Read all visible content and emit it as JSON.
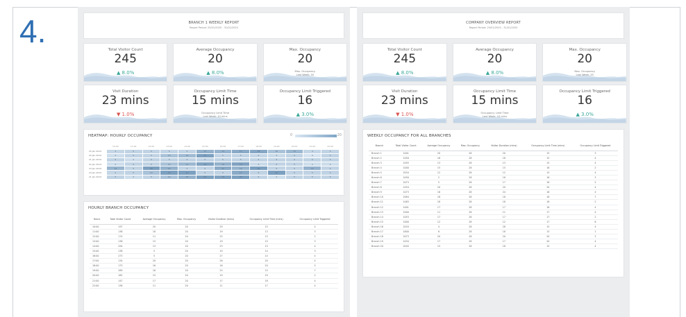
{
  "step_number": "4.",
  "branch_report": {
    "title": "BRANCH 1 WEEKLY REPORT",
    "period": "Report Period: 25/01/2020 - 31/01/2020",
    "kpis": [
      {
        "label": "Total Visitor Count",
        "value": "245",
        "change": "▲ 8.0%",
        "trend": "up"
      },
      {
        "label": "Average Occupancy",
        "value": "20",
        "change": "▲ 8.0%",
        "trend": "up"
      },
      {
        "label": "Max. Occupancy",
        "value": "20",
        "note1": "Max. Occupancy",
        "note2": "Last Week: 30"
      },
      {
        "label": "Visit Duration",
        "value": "23 mins",
        "change": "▼ 1.0%",
        "trend": "down"
      },
      {
        "label": "Occupancy Limit Time",
        "value": "15 mins",
        "note1": "Occupancy Limit Time",
        "note2": "Last Week: 10 mins"
      },
      {
        "label": "Occupancy Limit Triggered",
        "value": "16",
        "change": "▲ 3.0%",
        "trend": "up"
      }
    ],
    "heatmap": {
      "title": "HEATMAP: HOURLY OCCUPANCY",
      "legend_min": "0",
      "legend_max": "20",
      "hours": [
        "10:00",
        "11:00",
        "12:00",
        "13:00",
        "14:00",
        "15:00",
        "16:00",
        "17:00",
        "18:00",
        "19:00",
        "20:00",
        "21:00",
        "22:00"
      ],
      "rows": [
        {
          "date": "20 Jan 2019",
          "values": [
            4,
            5,
            5,
            5,
            5,
            15,
            14,
            17,
            18,
            10,
            13,
            4,
            5
          ]
        },
        {
          "date": "20 Jan 2019",
          "values": [
            2,
            5,
            5,
            10,
            12,
            20,
            5,
            5,
            4,
            3,
            5,
            0,
            5
          ]
        },
        {
          "date": "21 Jan 2019",
          "values": [
            5,
            2,
            5,
            5,
            5,
            5,
            5,
            5,
            5,
            5,
            5,
            5,
            5
          ]
        },
        {
          "date": "22 Jan 2019",
          "values": [
            2,
            5,
            5,
            10,
            13,
            19,
            15,
            19,
            3,
            5,
            5,
            2,
            2
          ]
        },
        {
          "date": "23 Jan 2019",
          "values": [
            14,
            5,
            20,
            15,
            5,
            5,
            17,
            14,
            20,
            5,
            5,
            15,
            5
          ]
        },
        {
          "date": "24 Jan 2019",
          "values": [
            4,
            5,
            10,
            20,
            20,
            5,
            5,
            17,
            5,
            20,
            5,
            5,
            5
          ]
        },
        {
          "date": "21 Jan 2019",
          "values": [
            5,
            2,
            5,
            10,
            15,
            20,
            19,
            20,
            5,
            2,
            5,
            5,
            5
          ]
        }
      ]
    },
    "hourly": {
      "title": "HOURLY BRANCH OCCUPANCY",
      "columns": [
        "Hours",
        "Total Visitor Count",
        "Average Occupancy",
        "Max. Occupancy",
        "Visitor Duration (mins)",
        "Occupancy Limit Time (mins)",
        "Occupancy Limit Triggered"
      ],
      "rows": [
        [
          "10:00",
          "197",
          "20",
          "20",
          "29",
          "15",
          "4"
        ],
        [
          "11:00",
          "138",
          "18",
          "20",
          "19",
          "13",
          "3"
        ],
        [
          "12:00",
          "174",
          "11",
          "20",
          "25",
          "15",
          "2"
        ],
        [
          "13:00",
          "136",
          "15",
          "20",
          "19",
          "15",
          "3"
        ],
        [
          "14:00",
          "294",
          "13",
          "20",
          "23",
          "15",
          "4"
        ],
        [
          "15:00",
          "138",
          "5",
          "20",
          "19",
          "14",
          "3"
        ],
        [
          "16:00",
          "273",
          "5",
          "20",
          "27",
          "14",
          "4"
        ],
        [
          "17:00",
          "134",
          "20",
          "20",
          "26",
          "20",
          "4"
        ],
        [
          "18:00",
          "173",
          "16",
          "20",
          "16",
          "20",
          "5"
        ],
        [
          "19:00",
          "289",
          "16",
          "20",
          "25",
          "15",
          "7"
        ],
        [
          "20:00",
          "182",
          "15",
          "20",
          "19",
          "19",
          "2"
        ],
        [
          "21:00",
          "147",
          "17",
          "20",
          "17",
          "18",
          "4"
        ],
        [
          "22:00",
          "138",
          "11",
          "20",
          "11",
          "17",
          "4"
        ]
      ]
    }
  },
  "company_report": {
    "title": "COMPANY OVERVIEW REPORT",
    "period": "Report Period: 25/01/2020 - 31/01/2020",
    "kpis": [
      {
        "label": "Total Visitor Count",
        "value": "245",
        "change": "▲ 8.0%",
        "trend": "up"
      },
      {
        "label": "Average Occupancy",
        "value": "20",
        "change": "▲ 8.0%",
        "trend": "up"
      },
      {
        "label": "Max. Occupancy",
        "value": "20",
        "note1": "Max. Occupancy",
        "note2": "Last Week: 35"
      },
      {
        "label": "Visit Duration",
        "value": "23 mins",
        "change": "▼ 1.0%",
        "trend": "down"
      },
      {
        "label": "Occupancy Limit Time",
        "value": "15 mins",
        "note1": "Occupancy Limit Time",
        "note2": "Last Week: 10 mins"
      },
      {
        "label": "Occupancy Limit Triggered",
        "value": "16",
        "change": "▲ 3.0%",
        "trend": "up"
      }
    ],
    "weekly": {
      "title": "WEEKLY OCCUPANCY FOR ALL BRANCHES",
      "columns": [
        "Branch",
        "Total Visitor Count",
        "Average Occupancy",
        "Max. Occupancy",
        "Visitor Duration (mins)",
        "Occupancy Limit Time (mins)",
        "Occupancy Limit Triggered"
      ],
      "rows": [
        [
          "Branch 1",
          "1001",
          "20",
          "28",
          "20",
          "15",
          "3"
        ],
        [
          "Branch 2",
          "1050",
          "16",
          "28",
          "18",
          "15",
          "4"
        ],
        [
          "Branch 3",
          "1055",
          "13",
          "28",
          "13",
          "15",
          "4"
        ],
        [
          "Branch 4",
          "1000",
          "15",
          "28",
          "15",
          "16",
          "2"
        ],
        [
          "Branch 5",
          "2034",
          "12",
          "28",
          "12",
          "15",
          "4"
        ],
        [
          "Branch 6",
          "1050",
          "2",
          "28",
          "18",
          "16",
          "3"
        ],
        [
          "Branch 7",
          "2073",
          "5",
          "28",
          "17",
          "18",
          "5"
        ],
        [
          "Branch 8",
          "1054",
          "20",
          "28",
          "20",
          "20",
          "4"
        ],
        [
          "Branch 9",
          "1073",
          "16",
          "28",
          "24",
          "16",
          "4"
        ],
        [
          "Branch 10",
          "2084",
          "18",
          "28",
          "18",
          "18",
          "7"
        ],
        [
          "Branch 11",
          "1083",
          "18",
          "28",
          "18",
          "18",
          "2"
        ],
        [
          "Branch 12",
          "1001",
          "17",
          "28",
          "17",
          "18",
          "4"
        ],
        [
          "Branch 13",
          "1000",
          "11",
          "28",
          "11",
          "17",
          "4"
        ],
        [
          "Branch 14",
          "1053",
          "17",
          "28",
          "17",
          "17",
          "2"
        ],
        [
          "Branch 15",
          "1000",
          "12",
          "28",
          "12",
          "17",
          "6"
        ],
        [
          "Branch 16",
          "2034",
          "4",
          "28",
          "28",
          "15",
          "4"
        ],
        [
          "Branch 17",
          "1800",
          "8",
          "28",
          "18",
          "13",
          "1"
        ],
        [
          "Branch 18",
          "2073",
          "20",
          "28",
          "20",
          "20",
          "3"
        ],
        [
          "Branch 19",
          "1034",
          "17",
          "28",
          "17",
          "20",
          "4"
        ],
        [
          "Branch 20",
          "2045",
          "15",
          "28",
          "18",
          "15",
          "4"
        ]
      ]
    }
  }
}
